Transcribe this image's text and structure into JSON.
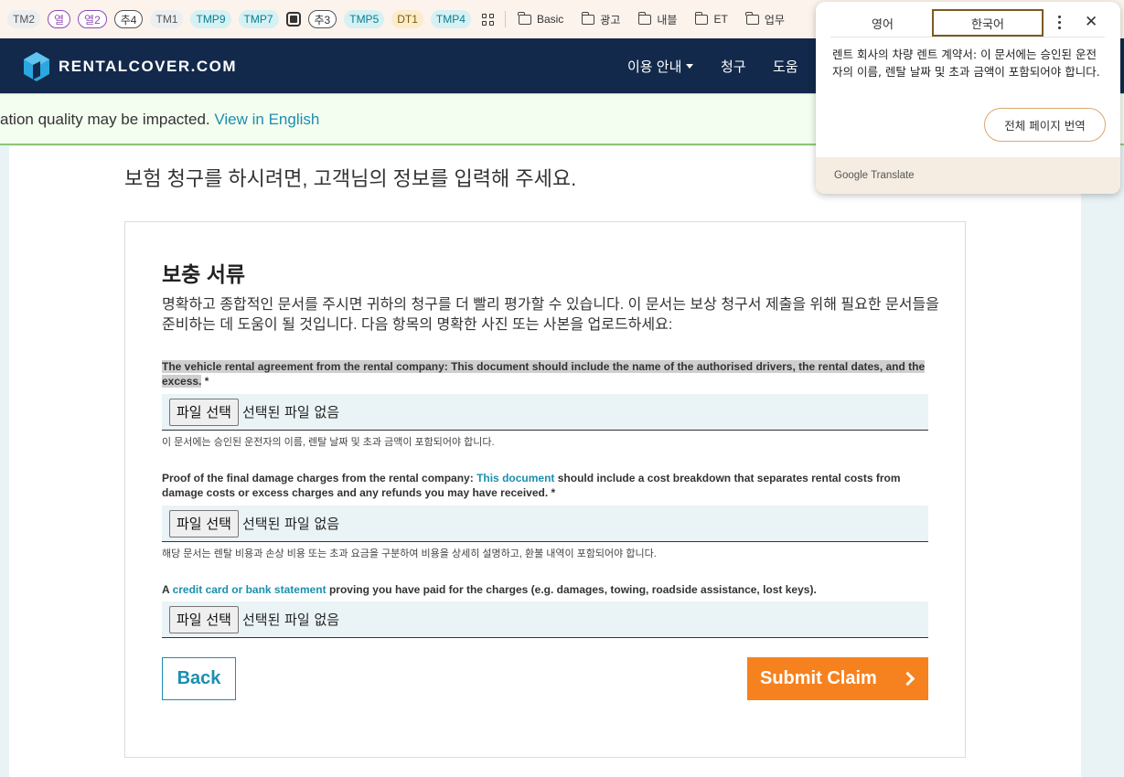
{
  "bookmarks": {
    "items": [
      {
        "label": "TM2",
        "style": "gray"
      },
      {
        "label": "열",
        "style": "purple"
      },
      {
        "label": "열2",
        "style": "purple"
      },
      {
        "label": "추4",
        "style": "dark"
      },
      {
        "label": "TM1",
        "style": "gray"
      },
      {
        "label": "TMP9",
        "style": "cyan"
      },
      {
        "label": "TMP7",
        "style": "cyan"
      }
    ],
    "items2": [
      {
        "label": "추3",
        "style": "dark"
      },
      {
        "label": "TMP5",
        "style": "cyan"
      },
      {
        "label": "DT1",
        "style": "yellow"
      },
      {
        "label": "TMP4",
        "style": "cyan"
      }
    ],
    "folders": [
      "Basic",
      "광고",
      "내블",
      "ET",
      "업무"
    ]
  },
  "header": {
    "logo_text": "RENTALCOVER.COM",
    "nav": {
      "guide": "이용 안내",
      "claims": "청구",
      "help": "도움"
    }
  },
  "banner": {
    "text": "ation quality may be impacted.",
    "link": "View in English"
  },
  "main": {
    "intro": "보험 청구를 하시려면, 고객님의 정보를 입력해 주세요.",
    "section_title": "보충 서류",
    "section_desc": "명확하고 종합적인 문서를 주시면 귀하의 청구를 더 빨리 평가할 수 있습니다. 이 문서는 보상 청구서 제출을 위해 필요한 문서들을 준비하는 데 도움이 될 것입니다. 다음 항목의 명확한 사진 또는 사본을 업로드하세요:",
    "docs": [
      {
        "label_highlighted": "The vehicle rental agreement from the rental company: This document should include the name of the authorised drivers, the rental dates, and the excess.",
        "required_mark": " *",
        "button": "파일 선택",
        "status": "선택된 파일 없음",
        "helper": "이 문서에는 승인된 운전자의 이름, 렌탈 날짜 및 초과 금액이 포함되어야 합니다."
      },
      {
        "label_before": "Proof of the final damage charges from the rental company: ",
        "label_link": "This document",
        "label_after": " should include a cost breakdown that separates rental costs from damage costs or excess charges and any refunds you may have received. *",
        "button": "파일 선택",
        "status": "선택된 파일 없음",
        "helper": "해당 문서는 렌탈 비용과 손상 비용 또는 초과 요금을 구분하여 비용을 상세히 설명하고, 환불 내역이 포함되어야 합니다."
      },
      {
        "label_before": "A ",
        "label_link": "credit card or bank statement",
        "label_after": " proving you have paid for the charges (e.g. damages, towing, roadside assistance, lost keys).",
        "button": "파일 선택",
        "status": "선택된 파일 없음"
      }
    ],
    "back_label": "Back",
    "submit_label": "Submit Claim"
  },
  "translate_popup": {
    "tab_source": "영어",
    "tab_target": "한국어",
    "text": "렌트 회사의 차량 렌트 계약서: 이 문서에는 승인된 운전자의 이름, 렌탈 날짜 및 초과 금액이 포함되어야 합니다.",
    "translate_page_label": "전체 페이지 번역",
    "footer": "Google Translate"
  },
  "colors": {
    "header_bg": "#13294b",
    "accent_teal": "#1b8fb0",
    "submit_orange": "#f6821f",
    "banner_bg": "#f3fdf0"
  }
}
